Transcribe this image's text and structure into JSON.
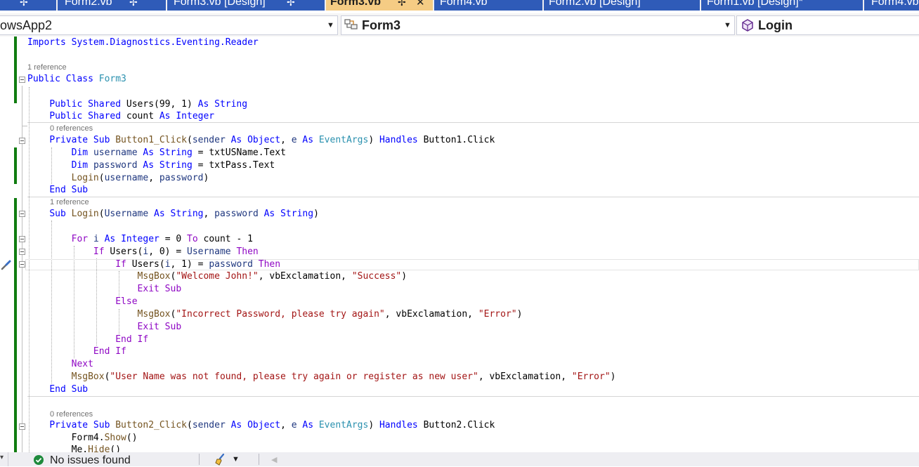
{
  "tabs": [
    {
      "label": "",
      "active": false
    },
    {
      "label": "Form2.vb",
      "active": false
    },
    {
      "label": "Form3.vb [Design]",
      "active": false
    },
    {
      "label": "Form3.vb",
      "active": true
    },
    {
      "label": "Form4.vb",
      "active": false
    },
    {
      "label": "Form2.vb [Design]",
      "active": false
    },
    {
      "label": "Form1.vb [Design]*",
      "active": false
    },
    {
      "label": "Form4.vb",
      "active": false
    }
  ],
  "nav": {
    "project": "owsApp2",
    "class": "Form3",
    "member": "Login"
  },
  "code": {
    "l1": "Imports System.Diagnostics.Eventing.Reader",
    "lens1": "1 reference",
    "l2_kw": "Public Class",
    "l2_name": "Form3",
    "l3_kw": "Public Shared",
    "l3_name": "Users(99, 1)",
    "l3_as": "As",
    "l3_type": "String",
    "l4_kw": "Public Shared",
    "l4_name": "count",
    "l4_as": "As",
    "l4_type": "Integer",
    "lens2": "0 references",
    "lens3": "1 reference",
    "lens4": "0 references",
    "msg1": "\"Welcome John!\"",
    "msg1b": "\"Success\"",
    "msg2": "\"Incorrect Password, please try again\"",
    "msg2b": "\"Error\"",
    "msg3": "\"User Name was not found, please try again or register as new user\"",
    "msg3b": "\"Error\""
  },
  "status": {
    "issues": "No issues found"
  },
  "colors": {
    "tab_inactive": "#2f5bb8",
    "tab_active": "#f5cc84",
    "keyword": "#0000ff",
    "control": "#8f08c4",
    "type": "#2b91af",
    "string": "#a31515",
    "method": "#74531f",
    "parameter": "#1f377f",
    "change_bar": "#107c10",
    "check_green": "#1e8a3c"
  },
  "icons": [
    "pin-icon",
    "close-icon",
    "dropdown-arrow-icon",
    "class-icon",
    "method-icon",
    "screwdriver-icon",
    "check-circle-icon",
    "brush-icon",
    "scroll-left-icon"
  ]
}
